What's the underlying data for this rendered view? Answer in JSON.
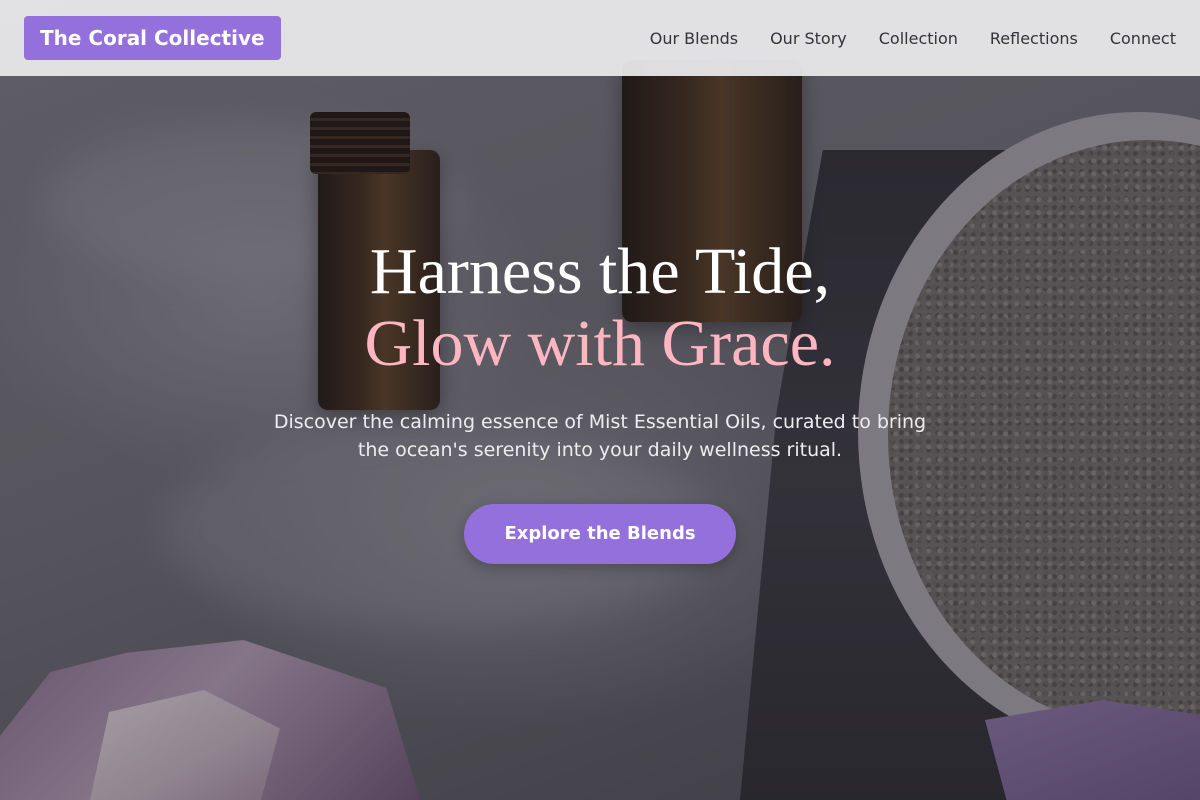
{
  "header": {
    "brand": "The Coral Collective",
    "nav": [
      {
        "label": "Our Blends"
      },
      {
        "label": "Our Story"
      },
      {
        "label": "Collection"
      },
      {
        "label": "Reflections"
      },
      {
        "label": "Connect"
      }
    ]
  },
  "hero": {
    "headline_line1": "Harness the Tide,",
    "headline_line2": "Glow with Grace.",
    "subtitle": "Discover the calming essence of Mist Essential Oils, curated to bring the ocean's serenity into your daily wellness ritual.",
    "cta_label": "Explore the Blends"
  },
  "colors": {
    "accent": "#9370db",
    "headline_highlight": "#ffb6c1",
    "nav_background": "#ececee"
  }
}
